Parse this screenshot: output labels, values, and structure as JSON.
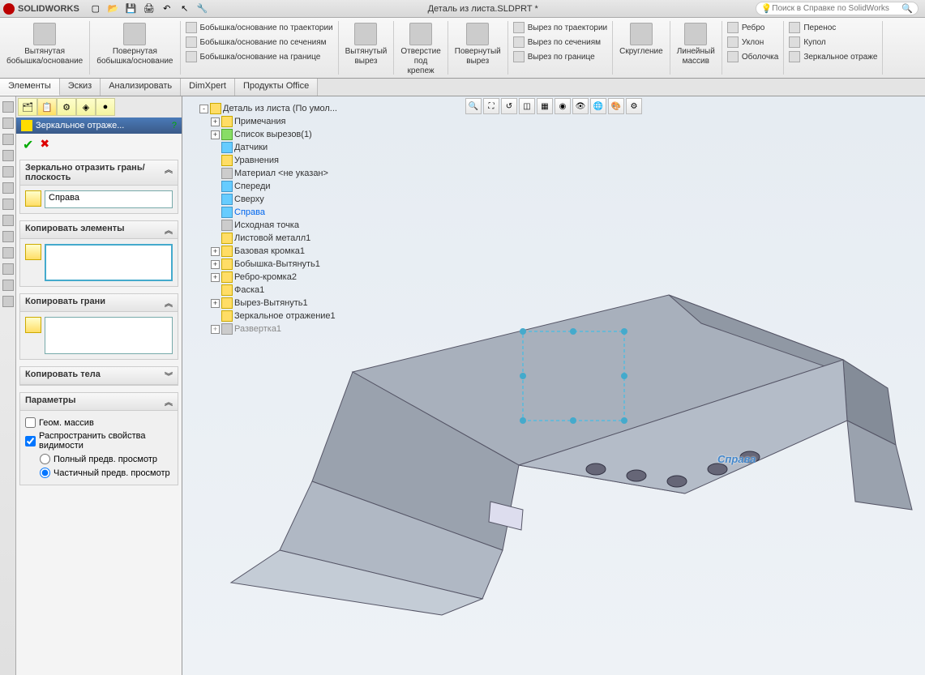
{
  "app": {
    "name": "SOLIDWORKS",
    "doc_title": "Деталь из листа.SLDPRT *",
    "search_placeholder": "Поиск в Справке по SolidWorks"
  },
  "ribbon": {
    "boss1": "Вытянутая\nбобышка/основание",
    "boss2": "Повернутая\nбобышка/основание",
    "boss_sweep": "Бобышка/основание по траектории",
    "boss_loft": "Бобышка/основание по сечениям",
    "boss_bound": "Бобышка/основание на границе",
    "cut1": "Вытянутый\nвырез",
    "cut2": "Отверстие\nпод\nкрепеж",
    "cut3": "Повернутый\nвырез",
    "cut_sweep": "Вырез по траектории",
    "cut_loft": "Вырез по сечениям",
    "cut_bound": "Вырез по границе",
    "fillet": "Скругление",
    "pattern": "Линейный\nмассив",
    "rib": "Ребро",
    "draft": "Уклон",
    "shell": "Оболочка",
    "wrap": "Перенос",
    "dome": "Купол",
    "mirror": "Зеркальное отраже"
  },
  "tabs": {
    "t1": "Элементы",
    "t2": "Эскиз",
    "t3": "Анализировать",
    "t4": "DimXpert",
    "t5": "Продукты Office"
  },
  "pm": {
    "title": "Зеркальное отраже...",
    "help": "?",
    "sec1": "Зеркально отразить грань/плоскость",
    "sec1_val": "Справа",
    "sec2": "Копировать элементы",
    "sec3": "Копировать грани",
    "sec4": "Копировать тела",
    "sec5": "Параметры",
    "chk1": "Геом. массив",
    "chk2": "Распространить свойства видимости",
    "rad1": "Полный предв. просмотр",
    "rad2": "Частичный предв. просмотр"
  },
  "tree": {
    "root": "Деталь из листа  (По умол...",
    "items": [
      "Примечания",
      "Список вырезов(1)",
      "Датчики",
      "Уравнения",
      "Материал <не указан>",
      "Спереди",
      "Сверху",
      "Справа",
      "Исходная точка",
      "Листовой металл1",
      "Базовая кромка1",
      "Бобышка-Вытянуть1",
      "Ребро-кромка2",
      "Фаска1",
      "Вырез-Вытянуть1",
      "Зеркальное отражение1",
      "Развертка1"
    ]
  },
  "plane_label": "Справа"
}
